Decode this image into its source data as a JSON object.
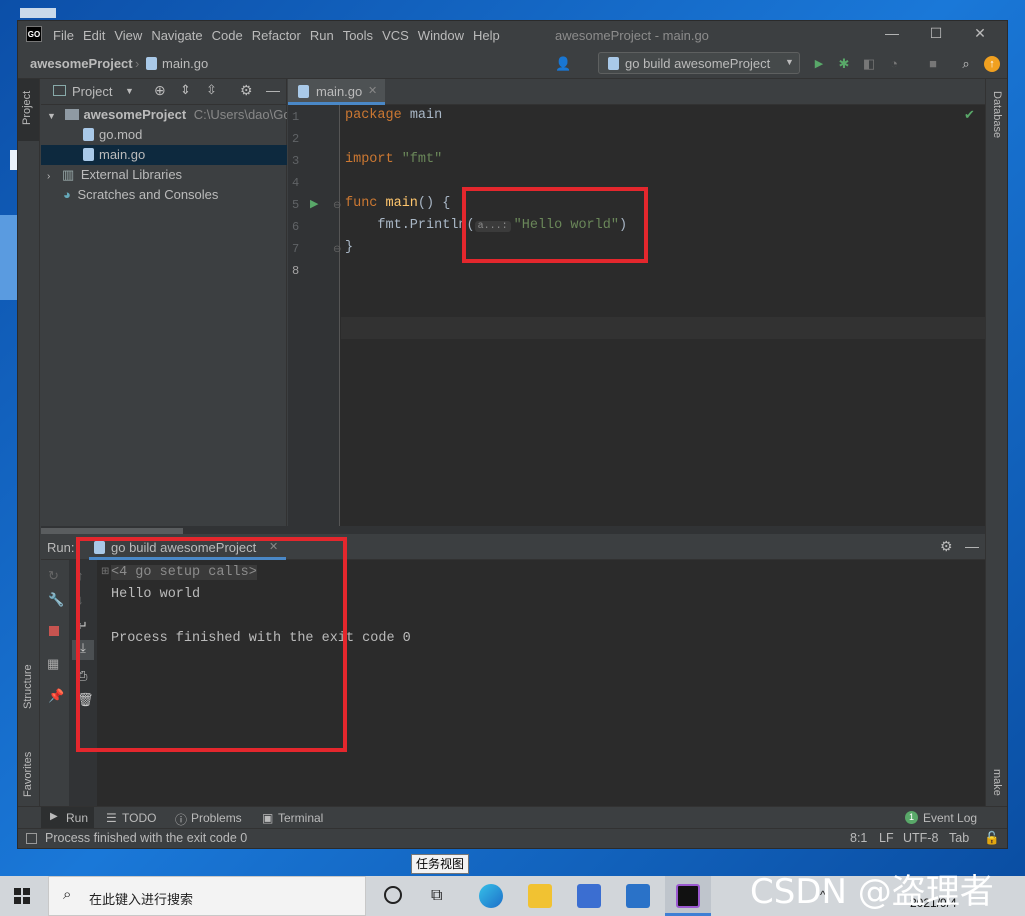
{
  "window": {
    "title": "awesomeProject - main.go",
    "logo": "GO",
    "menu": [
      "File",
      "Edit",
      "View",
      "Navigate",
      "Code",
      "Refactor",
      "Run",
      "Tools",
      "VCS",
      "Window",
      "Help"
    ],
    "controls": {
      "minimize": "—",
      "maximize": "☐",
      "close": "✕"
    }
  },
  "navbar": {
    "project": "awesomeProject",
    "file": "main.go",
    "run_config": "go build awesomeProject"
  },
  "left_strip": {
    "project": "Project",
    "structure": "Structure",
    "favorites": "Favorites"
  },
  "right_strip": {
    "database": "Database",
    "make": "make"
  },
  "project_panel": {
    "view_label": "Project",
    "tree": [
      {
        "label": "awesomeProject",
        "hint": "C:\\Users\\dao\\Go",
        "type": "folder"
      },
      {
        "label": "go.mod",
        "type": "file"
      },
      {
        "label": "main.go",
        "type": "file",
        "selected": true
      },
      {
        "label": "External Libraries",
        "type": "libs"
      },
      {
        "label": "Scratches and Consoles",
        "type": "scratch"
      }
    ]
  },
  "editor": {
    "tab_label": "main.go",
    "line_numbers": [
      "1",
      "2",
      "3",
      "4",
      "5",
      "6",
      "7",
      "8"
    ],
    "lines": {
      "l1_kw": "package",
      "l1_name": " main",
      "l3_kw": "import",
      "l3_str": " \"fmt\"",
      "l5_kw": "func",
      "l5_fn": " main",
      "l5_rest": "() {",
      "l6_call": "    fmt.Println(",
      "l6_hint": "a...:",
      "l6_str": "\"Hello world\"",
      "l6_close": ")",
      "l7": "}"
    }
  },
  "run_panel": {
    "label": "Run:",
    "tab_label": "go build awesomeProject",
    "output": [
      "<4 go setup calls>",
      "Hello world",
      "",
      "Process finished with the exit code 0"
    ]
  },
  "bottom_tabs": [
    "Run",
    "TODO",
    "Problems",
    "Terminal"
  ],
  "event_log": {
    "count": "1",
    "label": "Event Log"
  },
  "status": {
    "message": "Process finished with the exit code 0",
    "position": "8:1",
    "line_sep": "LF",
    "encoding": "UTF-8",
    "indent": "Tab"
  },
  "tooltip": "任务视图",
  "taskbar": {
    "search_placeholder": "在此键入进行搜索",
    "clock_date": "2021/9/4"
  },
  "watermark": "CSDN @盗理者",
  "colors": {
    "highlight_box": "#e4272d",
    "keyword": "#cc7832",
    "string": "#6a8759",
    "function": "#ffc66d"
  }
}
